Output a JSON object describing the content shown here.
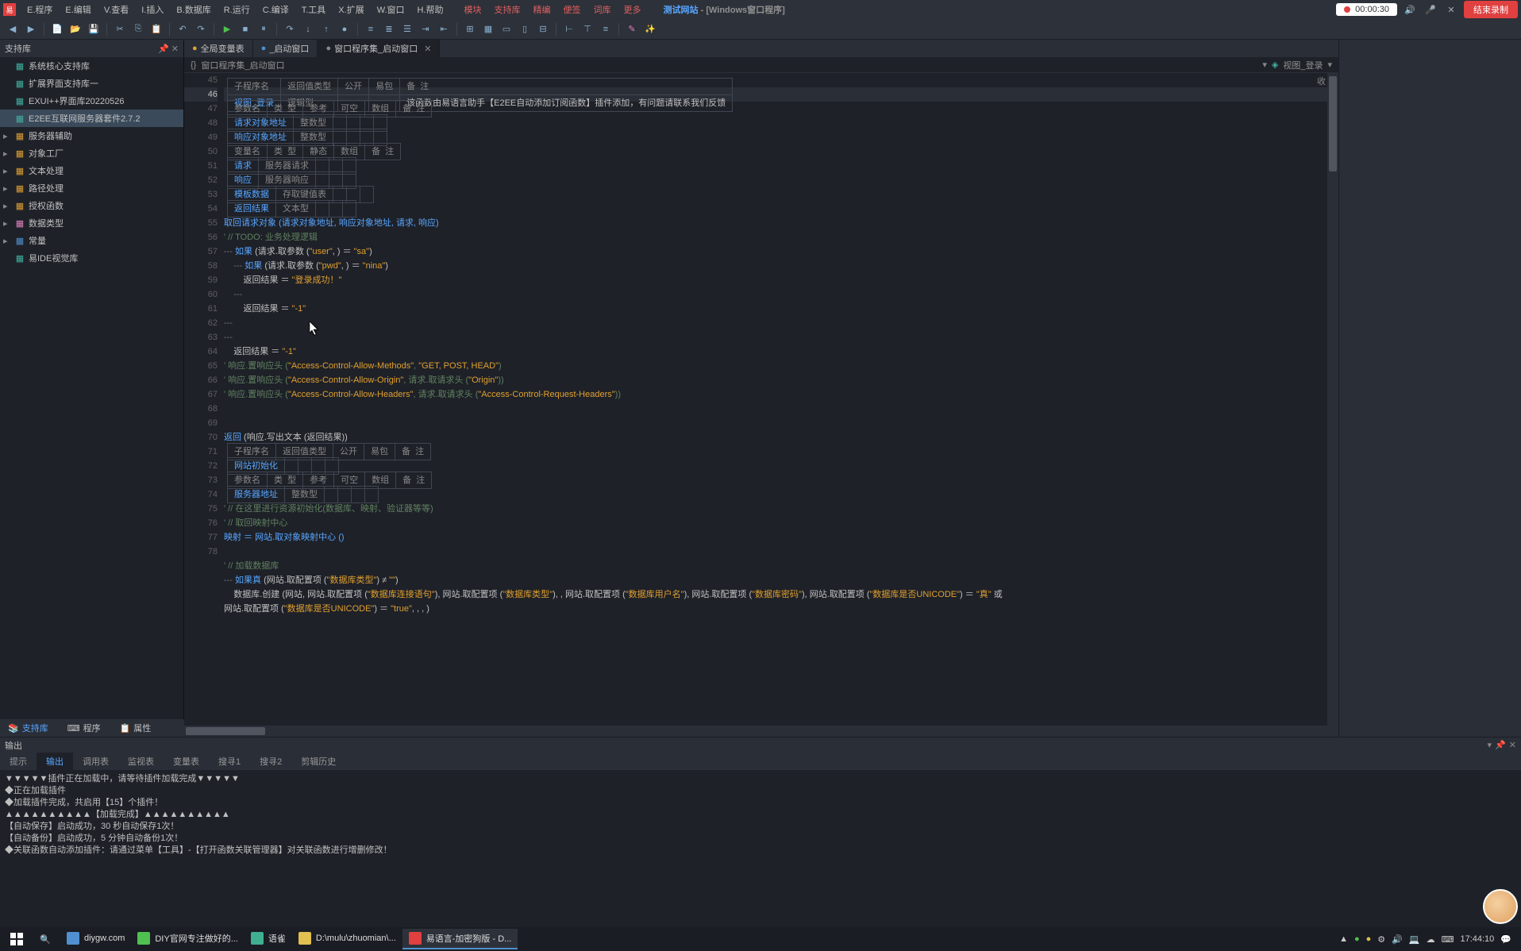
{
  "menubar": {
    "items": [
      "E.程序",
      "E.编辑",
      "V.查看",
      "I.插入",
      "B.数据库",
      "R.运行",
      "C.编译",
      "T.工具",
      "X.扩展",
      "W.窗口",
      "H.帮助"
    ],
    "red_items": [
      "模块",
      "支持库",
      "精编",
      "便签",
      "词库",
      "更多"
    ],
    "title_main": "测试网站",
    "title_sub": "- [Windows窗口程序]",
    "rec_time": "00:00:30",
    "end_label": "结束录制"
  },
  "sidebar": {
    "header": "支持库",
    "items": [
      {
        "label": "系统核心支持库",
        "icon": "teal"
      },
      {
        "label": "扩展界面支持库一",
        "icon": "teal"
      },
      {
        "label": "EXUI++界面库20220526",
        "icon": "teal"
      },
      {
        "label": "E2EE互联网服务器套件2.7.2",
        "icon": "teal",
        "selected": true
      },
      {
        "label": "服务器辅助",
        "icon": "orange",
        "expand": true
      },
      {
        "label": "对象工厂",
        "icon": "orange",
        "expand": true
      },
      {
        "label": "文本处理",
        "icon": "orange",
        "expand": true
      },
      {
        "label": "路径处理",
        "icon": "orange",
        "expand": true
      },
      {
        "label": "授权函数",
        "icon": "orange",
        "expand": true
      },
      {
        "label": "数据类型",
        "icon": "pink",
        "expand": true
      },
      {
        "label": "常量",
        "icon": "blue",
        "expand": true
      },
      {
        "label": "易IDE视觉库",
        "icon": "teal"
      }
    ]
  },
  "editor_tabs": [
    {
      "label": "全局变量表",
      "color": "#e0a030"
    },
    {
      "label": "_启动窗口",
      "color": "#5090d0"
    },
    {
      "label": "窗口程序集_启动窗口",
      "color": "#888",
      "active": true,
      "close": true
    }
  ],
  "breadcrumb": {
    "left_icon": "{}",
    "left": "窗口程序集_启动窗口",
    "right_icon": "◈",
    "right": "视图_登录"
  },
  "collapse_label": "收",
  "code": {
    "first_ln": 45,
    "sub_table1": {
      "headers": [
        "子程序名",
        "返回值类型",
        "公开",
        "易包",
        "备  注"
      ],
      "row": [
        "视图_登录",
        "逻辑型",
        "",
        "",
        "该函数由易语言助手【E2EE自动添加订阅函数】插件添加，有问题请联系我们反馈"
      ]
    },
    "param_table1": {
      "headers": [
        "参数名",
        "类  型",
        "参考",
        "可空",
        "数组",
        "备  注"
      ],
      "rows": [
        [
          "请求对象地址",
          "整数型",
          "",
          "",
          "",
          ""
        ],
        [
          "响应对象地址",
          "整数型",
          "",
          "",
          "",
          ""
        ]
      ]
    },
    "var_table": {
      "headers": [
        "变量名",
        "类  型",
        "静态",
        "数组",
        "备  注"
      ],
      "rows": [
        [
          "请求",
          "服务器请求",
          "",
          "",
          ""
        ],
        [
          "响应",
          "服务器响应",
          "",
          "",
          ""
        ],
        [
          "模板数据",
          "存取键值表",
          "",
          "",
          ""
        ],
        [
          "返回结果",
          "文本型",
          "",
          "",
          ""
        ]
      ]
    },
    "lines": {
      "53": "取回请求对象 (请求对象地址, 响应对象地址, 请求, 响应)",
      "54": "' // TODO: 业务处理逻辑",
      "55_pre": "--- ",
      "55_kw": "如果",
      "55_rest": " (请求.取参数 (",
      "55_s1": "\"user\"",
      "55_mid": ", ) ＝ ",
      "55_s2": "\"sa\"",
      "55_end": ")",
      "56_pre": "    --- ",
      "56_kw": "如果",
      "56_rest": " (请求.取参数 (",
      "56_s1": "\"pwd\"",
      "56_mid": ", ) ＝ ",
      "56_s2": "\"nina\"",
      "56_end": ")",
      "57": "        返回结果 ＝ ",
      "57_s": "\"登录成功！\"",
      "58": "    ---",
      "59": "        返回结果 ＝ ",
      "59_s": "\"-1\"",
      "60": "---",
      "61": "---",
      "62": "    返回结果 ＝ ",
      "62_s": "\"-1\"",
      "63_a": "' 响应.置响应头 (",
      "63_s1": "\"Access-Control-Allow-Methods\"",
      "63_b": ", ",
      "63_s2": "\"GET, POST, HEAD\"",
      "63_c": ")",
      "64_a": "' 响应.置响应头 (",
      "64_s1": "\"Access-Control-Allow-Origin\"",
      "64_b": ", 请求.取请求头 (",
      "64_s2": "\"Origin\"",
      "64_c": "))",
      "65_a": "' 响应.置响应头 (",
      "65_s1": "\"Access-Control-Allow-Headers\"",
      "65_b": ", 请求.取请求头 (",
      "65_s2": "\"Access-Control-Request-Headers\"",
      "65_c": "))",
      "68_kw": "返回",
      "68_rest": " (响应.写出文本 (返回结果))"
    },
    "sub_table2": {
      "headers": [
        "子程序名",
        "返回值类型",
        "公开",
        "易包",
        "备  注"
      ],
      "row": [
        "网站初始化",
        "",
        "",
        "",
        ""
      ]
    },
    "param_table2": {
      "headers": [
        "参数名",
        "类  型",
        "参考",
        "可空",
        "数组",
        "备  注"
      ],
      "rows": [
        [
          "服务器地址",
          "整数型",
          "",
          "",
          "",
          ""
        ]
      ]
    },
    "lines2": {
      "71": "' // 在这里进行资源初始化(数据库、映射、验证器等等)",
      "72": "' // 取回映射中心",
      "73_a": "映射 ＝ 网站.取对象映射中心 ()",
      "75": "' // 加载数据库",
      "76_pre": "--- ",
      "76_kw": "如果真",
      "76_rest": " (网站.取配置项 (",
      "76_s": "\"数据库类型\"",
      "76_end": ") ≠ ",
      "76_s2": "\"\"",
      "76_c": ")",
      "77_a": "    数据库.创建 (网站, 网站.取配置项 (",
      "77_s1": "\"数据库连接语句\"",
      "77_b": "), 网站.取配置项 (",
      "77_s2": "\"数据库类型\"",
      "77_c": "), , 网站.取配置项 (",
      "77_s3": "\"数据库用户名\"",
      "77_d": "), 网站.取配置项 (",
      "77_s4": "\"数据库密码\"",
      "77_e": "), 网站.取配置项 (",
      "77_s5": "\"数据库是否UNICODE\"",
      "77_f": ") ＝ ",
      "77_s6": "\"真\"",
      "77_g": " 或",
      "77b_a": "网站.取配置项 (",
      "77b_s": "\"数据库是否UNICODE\"",
      "77b_b": ") ＝ ",
      "77b_s2": "\"true\"",
      "77b_c": ", , , )"
    }
  },
  "bottom_tabs": [
    "支持库",
    "程序",
    "属性"
  ],
  "output": {
    "header": "输出",
    "tabs": [
      "提示",
      "输出",
      "调用表",
      "监视表",
      "变量表",
      "搜寻1",
      "搜寻2",
      "剪辑历史"
    ],
    "active_tab": 1,
    "lines": [
      "▼▼▼▼▼插件正在加载中，请等待插件加载完成▼▼▼▼▼",
      "◆正在加载插件",
      "◆加载插件完成，共启用【15】个插件！",
      "▲▲▲▲▲▲▲▲▲▲【加载完成】▲▲▲▲▲▲▲▲▲▲",
      "【自动保存】启动成功，30 秒自动保存1次！",
      "【自动备份】启动成功，5 分钟自动备份1次！",
      "◆关联函数自动添加插件：请通过菜单【工具】-【打开函数关联管理器】对关联函数进行增删修改！"
    ]
  },
  "taskbar": {
    "items": [
      {
        "label": "diygw.com",
        "icon": "#5090d0"
      },
      {
        "label": "DIY官网专注做好的...",
        "icon": "#50c050"
      },
      {
        "label": "语雀",
        "icon": "#40b090"
      },
      {
        "label": "D:\\mulu\\zhuomian\\...",
        "icon": "#e0c050"
      },
      {
        "label": "易语言-加密狗版 - D...",
        "icon": "#e04040",
        "active": true
      }
    ],
    "clock": "17:44:10"
  }
}
